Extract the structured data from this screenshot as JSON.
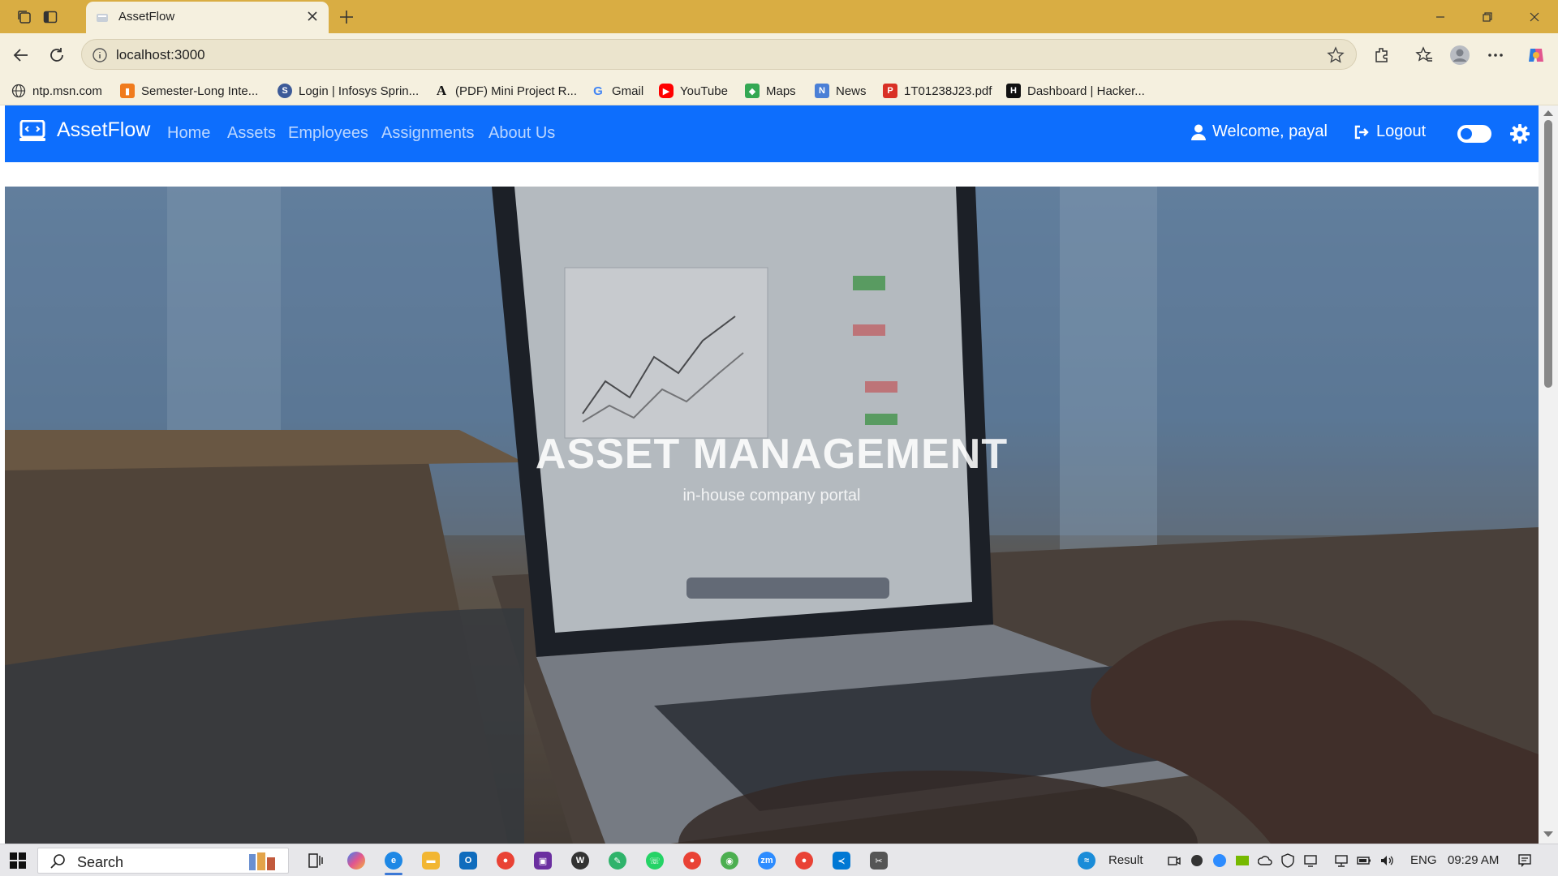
{
  "browser": {
    "tab": {
      "title": "AssetFlow"
    },
    "address": "localhost:3000",
    "bookmarks": [
      {
        "label": "ntp.msn.com",
        "icon": "globe-icon"
      },
      {
        "label": "Semester-Long Inte...",
        "icon": "orange-bookmark-icon"
      },
      {
        "label": "Login | Infosys Sprin...",
        "icon": "infosys-icon"
      },
      {
        "label": "(PDF) Mini Project R...",
        "icon": "academia-icon"
      },
      {
        "label": "Gmail",
        "icon": "google-icon"
      },
      {
        "label": "YouTube",
        "icon": "youtube-icon"
      },
      {
        "label": "Maps",
        "icon": "maps-icon"
      },
      {
        "label": "News",
        "icon": "news-icon"
      },
      {
        "label": "1T01238J23.pdf",
        "icon": "pdf-icon"
      },
      {
        "label": "Dashboard | Hacker...",
        "icon": "hackerrank-icon"
      }
    ]
  },
  "navbar": {
    "brand": "AssetFlow",
    "links": [
      "Home",
      "Assets",
      "Employees",
      "Assignments",
      "About Us"
    ],
    "welcome": "Welcome, payal",
    "logout": "Logout"
  },
  "hero": {
    "title": "ASSET MANAGEMENT",
    "subtitle": "in-house company portal"
  },
  "taskbar": {
    "search": "Search",
    "weather": "Result",
    "language": "ENG",
    "time": "09:29 AM"
  },
  "colors": {
    "tabbar": "#d9ad43",
    "chrome": "#f5f0df",
    "navbar": "#0d6efd"
  }
}
